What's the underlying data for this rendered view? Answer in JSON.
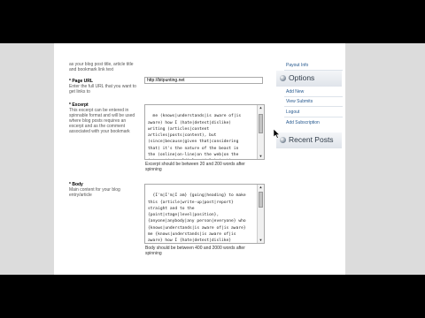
{
  "form": {
    "intro_lines": [
      "as your blog post title, article title",
      "and bookmark link text"
    ],
    "page_url": {
      "label": "* Page URL",
      "help_lines": [
        "Enter the full URL that you want to",
        "get links to"
      ],
      "value": "http://bitpunting.net"
    },
    "excerpt": {
      "label": "* Excerpt",
      "help_lines": [
        "This excerpt can be entered in",
        "spinnable format and will be used",
        "where blog posts requires an",
        "excerpt and as the comment",
        "associated with your bookmark"
      ],
      "text": "me (knows|understands|is aware of|is\naware) how I (hate|detest|dislike)\nwriting (articles|content\narticles|posts|content), but\n(since|because|given that|considering\nthat) it's the nature of the beast in\nthe (online|on-line|on the web|on the\ninternet) (world|planet|globe|entire\nworld) in which we\n(live|reside|dwell|stay) and do\n(business|company|enterprise|organization",
      "hint_lines": [
        "Excerpt should be between 20 and 200 words after",
        "spinning"
      ]
    },
    "body": {
      "label": "* Body",
      "help_lines": [
        "Main content for your blog",
        "entry/article"
      ],
      "text": "{I'm|I'm|I am} {going|heading} to make\nthis {article|write-up|post|report}\nstraight and to the\n{point|stage|level|position},\n{anyone|anybody|any person|everyone} who\n{knows|understands|is aware of|is aware}\nme {knows|understands|is aware of|is\naware} how I {hate|detest|dislike}\nwriting {articles|content\narticles|posts|content}, but\n{since|because|given that|considering",
      "hint_lines": [
        "Body should be between 400 and 2000 words after",
        "spinning"
      ]
    }
  },
  "sidebar": {
    "top_link": "Payout Info",
    "options_title": "Options",
    "options_links": [
      "Add New",
      "View Submits",
      "Logout",
      "Add Subscription"
    ],
    "recent_title": "Recent Posts"
  },
  "colors": {
    "link": "#25588e",
    "page_bg": "#ffffff",
    "frame_bg": "#dcdcdc"
  },
  "icons": {
    "section_icon": "disc-icon",
    "cursor": "mouse-cursor-icon"
  }
}
